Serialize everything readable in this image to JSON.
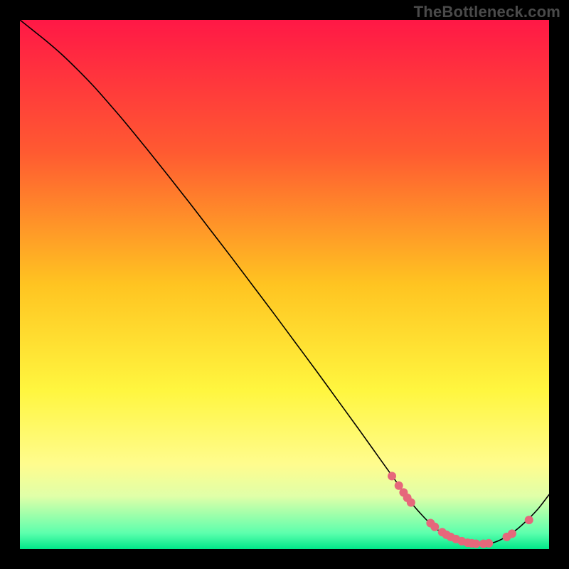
{
  "watermark": "TheBottleneck.com",
  "chart_data": {
    "type": "line",
    "title": "",
    "xlabel": "",
    "ylabel": "",
    "xlim": [
      0,
      100
    ],
    "ylim": [
      0,
      100
    ],
    "grid": false,
    "legend": false,
    "background_gradient": {
      "type": "vertical",
      "stops": [
        {
          "pos": 0,
          "color": "#ff1846"
        },
        {
          "pos": 25,
          "color": "#ff5a31"
        },
        {
          "pos": 50,
          "color": "#ffc421"
        },
        {
          "pos": 70,
          "color": "#fff63f"
        },
        {
          "pos": 84,
          "color": "#fffc8e"
        },
        {
          "pos": 90,
          "color": "#e0ffa8"
        },
        {
          "pos": 97,
          "color": "#5cffad"
        },
        {
          "pos": 100,
          "color": "#00e789"
        }
      ]
    },
    "series": [
      {
        "name": "curve",
        "stroke": "#000000",
        "stroke_width": 1.6,
        "x": [
          0,
          2,
          5,
          8,
          11,
          14,
          17,
          20,
          24,
          28,
          32,
          36,
          40,
          44,
          48,
          52,
          56,
          60,
          64,
          68,
          72,
          74,
          76,
          78,
          80,
          82,
          84,
          86,
          88,
          90,
          92,
          94,
          96,
          98,
          100
        ],
        "y": [
          100,
          98.4,
          96.0,
          93.4,
          90.5,
          87.4,
          84.0,
          80.5,
          75.6,
          70.6,
          65.5,
          60.3,
          55.1,
          49.8,
          44.5,
          39.1,
          33.7,
          28.2,
          22.7,
          17.1,
          11.5,
          8.7,
          6.4,
          4.4,
          2.9,
          1.8,
          1.1,
          0.8,
          0.9,
          1.4,
          2.4,
          3.8,
          5.6,
          7.7,
          10.3
        ]
      }
    ],
    "points": {
      "name": "dots",
      "color": "#e6677b",
      "radius": 6,
      "x": [
        70.3,
        71.6,
        72.5,
        73.2,
        73.9,
        77.6,
        78.4,
        79.8,
        80.6,
        81.4,
        82.4,
        83.5,
        84.6,
        85.4,
        86.2,
        87.6,
        88.6,
        92.0,
        93.0,
        96.2
      ],
      "y": [
        13.8,
        12.0,
        10.7,
        9.7,
        8.8,
        4.9,
        4.2,
        3.2,
        2.7,
        2.3,
        1.9,
        1.5,
        1.2,
        1.1,
        1.0,
        1.0,
        1.1,
        2.3,
        2.9,
        5.5
      ]
    }
  }
}
